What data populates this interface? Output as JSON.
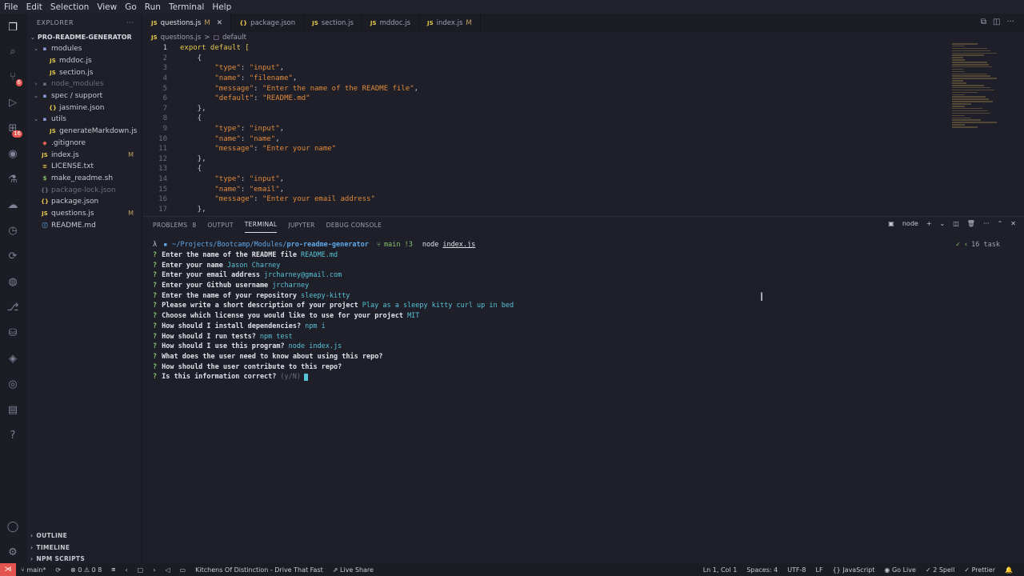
{
  "menu": [
    "File",
    "Edit",
    "Selection",
    "View",
    "Go",
    "Run",
    "Terminal",
    "Help"
  ],
  "activity": {
    "scm_badge": "6",
    "ext_badge": "16"
  },
  "explorer": {
    "title": "EXPLORER",
    "more": "···",
    "root": "PRO-README-GENERATOR",
    "items": [
      {
        "label": "modules",
        "kind": "folder",
        "open": true,
        "depth": 1,
        "icon": "▪"
      },
      {
        "label": "mddoc.js",
        "kind": "js",
        "depth": 2,
        "icon": "JS"
      },
      {
        "label": "section.js",
        "kind": "js",
        "depth": 2,
        "icon": "JS"
      },
      {
        "label": "node_modules",
        "kind": "folder",
        "open": false,
        "depth": 1,
        "dim": true,
        "icon": "▪"
      },
      {
        "label": "spec / support",
        "kind": "folder",
        "open": true,
        "depth": 1,
        "icon": "▪"
      },
      {
        "label": "jasmine.json",
        "kind": "jsonc",
        "depth": 2,
        "icon": "{}"
      },
      {
        "label": "utils",
        "kind": "folder",
        "open": true,
        "depth": 1,
        "icon": "▪"
      },
      {
        "label": "generateMarkdown.js",
        "kind": "js",
        "depth": 2,
        "icon": "JS"
      },
      {
        "label": ".gitignore",
        "kind": "git",
        "depth": 1,
        "icon": "◆"
      },
      {
        "label": "index.js",
        "kind": "js",
        "depth": 1,
        "mark": "M",
        "icon": "JS"
      },
      {
        "label": "LICENSE.txt",
        "kind": "lic",
        "depth": 1,
        "icon": "≡"
      },
      {
        "label": "make_readme.sh",
        "kind": "sh",
        "depth": 1,
        "icon": "$"
      },
      {
        "label": "package-lock.json",
        "kind": "jsonc",
        "depth": 1,
        "dim": true,
        "icon": "{}"
      },
      {
        "label": "package.json",
        "kind": "jsonc",
        "depth": 1,
        "icon": "{}"
      },
      {
        "label": "questions.js",
        "kind": "js",
        "depth": 1,
        "mark": "M",
        "icon": "JS"
      },
      {
        "label": "README.md",
        "kind": "md",
        "depth": 1,
        "icon": "ⓘ"
      }
    ],
    "outline": "OUTLINE",
    "timeline": "TIMELINE",
    "npm_scripts": "NPM SCRIPTS"
  },
  "tabs": [
    {
      "label": "questions.js",
      "mark": "M",
      "icon": "JS",
      "kind": "js",
      "active": true
    },
    {
      "label": "package.json",
      "icon": "{}",
      "kind": "jsonc"
    },
    {
      "label": "section.js",
      "icon": "JS",
      "kind": "js"
    },
    {
      "label": "mddoc.js",
      "icon": "JS",
      "kind": "js"
    },
    {
      "label": "index.js",
      "mark": "M",
      "icon": "JS",
      "kind": "js"
    }
  ],
  "breadcrumb": {
    "file": "questions.js",
    "sep": ">",
    "symbol": "default"
  },
  "code": [
    {
      "n": "1",
      "t": [
        [
          "kw",
          "export default "
        ],
        [
          "brk",
          "["
        ]
      ]
    },
    {
      "n": "2",
      "t": [
        [
          "pun",
          "    {"
        ]
      ]
    },
    {
      "n": "3",
      "t": [
        [
          "pun",
          "        "
        ],
        [
          "str",
          "\"type\""
        ],
        [
          "pun",
          ": "
        ],
        [
          "str",
          "\"input\""
        ],
        [
          "pun",
          ","
        ]
      ]
    },
    {
      "n": "4",
      "t": [
        [
          "pun",
          "        "
        ],
        [
          "str",
          "\"name\""
        ],
        [
          "pun",
          ": "
        ],
        [
          "str",
          "\"filename\""
        ],
        [
          "pun",
          ","
        ]
      ]
    },
    {
      "n": "5",
      "t": [
        [
          "pun",
          "        "
        ],
        [
          "str",
          "\"message\""
        ],
        [
          "pun",
          ": "
        ],
        [
          "str",
          "\"Enter the name of the README file\""
        ],
        [
          "pun",
          ","
        ]
      ]
    },
    {
      "n": "6",
      "t": [
        [
          "pun",
          "        "
        ],
        [
          "str",
          "\"default\""
        ],
        [
          "pun",
          ": "
        ],
        [
          "str",
          "\"README.md\""
        ]
      ]
    },
    {
      "n": "7",
      "t": [
        [
          "pun",
          "    },"
        ]
      ]
    },
    {
      "n": "8",
      "t": [
        [
          "pun",
          "    {"
        ]
      ]
    },
    {
      "n": "9",
      "t": [
        [
          "pun",
          "        "
        ],
        [
          "str",
          "\"type\""
        ],
        [
          "pun",
          ": "
        ],
        [
          "str",
          "\"input\""
        ],
        [
          "pun",
          ","
        ]
      ]
    },
    {
      "n": "10",
      "t": [
        [
          "pun",
          "        "
        ],
        [
          "str",
          "\"name\""
        ],
        [
          "pun",
          ": "
        ],
        [
          "str",
          "\"name\""
        ],
        [
          "pun",
          ","
        ]
      ]
    },
    {
      "n": "11",
      "t": [
        [
          "pun",
          "        "
        ],
        [
          "str",
          "\"message\""
        ],
        [
          "pun",
          ": "
        ],
        [
          "str",
          "\"Enter your name\""
        ]
      ]
    },
    {
      "n": "12",
      "t": [
        [
          "pun",
          "    },"
        ]
      ]
    },
    {
      "n": "13",
      "t": [
        [
          "pun",
          "    {"
        ]
      ]
    },
    {
      "n": "14",
      "t": [
        [
          "pun",
          "        "
        ],
        [
          "str",
          "\"type\""
        ],
        [
          "pun",
          ": "
        ],
        [
          "str",
          "\"input\""
        ],
        [
          "pun",
          ","
        ]
      ]
    },
    {
      "n": "15",
      "t": [
        [
          "pun",
          "        "
        ],
        [
          "str",
          "\"name\""
        ],
        [
          "pun",
          ": "
        ],
        [
          "str",
          "\"email\""
        ],
        [
          "pun",
          ","
        ]
      ]
    },
    {
      "n": "16",
      "t": [
        [
          "pun",
          "        "
        ],
        [
          "str",
          "\"message\""
        ],
        [
          "pun",
          ": "
        ],
        [
          "str",
          "\"Enter your email address\""
        ]
      ]
    },
    {
      "n": "17",
      "t": [
        [
          "pun",
          "    },"
        ]
      ]
    }
  ],
  "panel": {
    "tabs": [
      {
        "label": "PROBLEMS",
        "badge": "8"
      },
      {
        "label": "OUTPUT"
      },
      {
        "label": "TERMINAL",
        "active": true
      },
      {
        "label": "JUPYTER"
      },
      {
        "label": "DEBUG CONSOLE"
      }
    ],
    "shell": "node"
  },
  "terminal": {
    "prompt": {
      "arrow": "λ",
      "path": "~/Projects/Bootcamp/Modules/",
      "path_bold": "pro-readme-generator",
      "branch": "main !3",
      "cmd": "node",
      "cmd_arg": "index.js"
    },
    "task": "16 task",
    "lines": [
      {
        "q": "Enter the name of the README file",
        "a": "README.md"
      },
      {
        "q": "Enter your name",
        "a": "Jason Charney"
      },
      {
        "q": "Enter your email address",
        "a": "jrcharney@gmail.com"
      },
      {
        "q": "Enter your Github username",
        "a": "jrcharney"
      },
      {
        "q": "Enter the name of your repository",
        "a": "sleepy-kitty"
      },
      {
        "q": "Please write a short description of your project",
        "a": "Play as a sleepy kitty curl up in bed"
      },
      {
        "q": "Choose which license you would like to use for your project",
        "a": "MIT"
      },
      {
        "q": "How should I install dependencies?",
        "a": "npm i"
      },
      {
        "q": "How should I run tests?",
        "a": "npm test"
      },
      {
        "q": "How should I use this program?",
        "a": "node index.js"
      },
      {
        "q": "What does the user need to know about using this repo?",
        "a": ""
      },
      {
        "q": "How should the user contribute to this repo?",
        "a": ""
      },
      {
        "q": "Is this information correct?",
        "a": "",
        "hint": "(y/N)",
        "cursor": true
      }
    ]
  },
  "status": {
    "branch": "main*",
    "problems": "⊗ 0 ⚠ 0 8",
    "music": "Kitchens Of Distinction - Drive That Fast",
    "liveshare": "Live Share",
    "position": "Ln 1, Col 1",
    "spaces": "Spaces: 4",
    "encoding": "UTF-8",
    "eol": "LF",
    "language": "JavaScript",
    "golive": "Go Live",
    "spell": "2 Spell",
    "prettier": "Prettier"
  }
}
